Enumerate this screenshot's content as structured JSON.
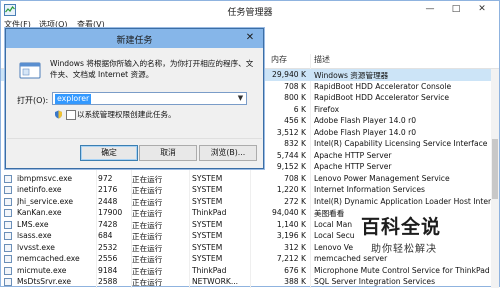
{
  "window": {
    "title": "任务管理器",
    "controls": [
      "—",
      "□",
      "✕"
    ]
  },
  "menubar": [
    {
      "label": "文件(F)"
    },
    {
      "label": "选项(O)"
    },
    {
      "label": "查看(V)"
    }
  ],
  "columns": {
    "name": "",
    "pid": "",
    "status": "",
    "user": "",
    "memory": "内存",
    "description": "描述"
  },
  "rows": [
    {
      "name": "",
      "pid": "",
      "status": "",
      "user": "",
      "memory": "29,940 K",
      "description": "Windows 资源管理器"
    },
    {
      "name": "",
      "pid": "",
      "status": "",
      "user": "",
      "memory": "708 K",
      "description": "RapidBoot HDD Accelerator Console"
    },
    {
      "name": "",
      "pid": "",
      "status": "",
      "user": "",
      "memory": "800 K",
      "description": "RapidBoot HDD Accelerator Service"
    },
    {
      "name": "",
      "pid": "",
      "status": "",
      "user": "",
      "memory": "6 K",
      "description": "Firefox"
    },
    {
      "name": "",
      "pid": "",
      "status": "",
      "user": "",
      "memory": "456 K",
      "description": "Adobe Flash Player 14.0 r0"
    },
    {
      "name": "",
      "pid": "",
      "status": "",
      "user": "",
      "memory": "3,512 K",
      "description": "Adobe Flash Player 14.0 r0"
    },
    {
      "name": "",
      "pid": "",
      "status": "",
      "user": "",
      "memory": "832 K",
      "description": "Intel(R) Capability Licensing Service Interface"
    },
    {
      "name": "",
      "pid": "",
      "status": "",
      "user": "",
      "memory": "5,744 K",
      "description": "Apache HTTP Server"
    },
    {
      "name": "",
      "pid": "",
      "status": "",
      "user": "",
      "memory": "9,152 K",
      "description": "Apache HTTP Server"
    },
    {
      "name": "ibmpmsvc.exe",
      "pid": "972",
      "status": "正在运行",
      "user": "SYSTEM",
      "memory": "708 K",
      "description": "Lenovo Power Management Service"
    },
    {
      "name": "inetinfo.exe",
      "pid": "2176",
      "status": "正在运行",
      "user": "SYSTEM",
      "memory": "1,220 K",
      "description": "Internet Information Services"
    },
    {
      "name": "Jhi_service.exe",
      "pid": "2448",
      "status": "正在运行",
      "user": "SYSTEM",
      "memory": "272 K",
      "description": "Intel(R) Dynamic Application Loader Host Interface"
    },
    {
      "name": "KanKan.exe",
      "pid": "17900",
      "status": "正在运行",
      "user": "ThinkPad",
      "memory": "94,040 K",
      "description": "美图看看"
    },
    {
      "name": "LMS.exe",
      "pid": "7428",
      "status": "正在运行",
      "user": "SYSTEM",
      "memory": "1,140 K",
      "description": "Local Man"
    },
    {
      "name": "lsass.exe",
      "pid": "684",
      "status": "正在运行",
      "user": "SYSTEM",
      "memory": "3,196 K",
      "description": "Local Secu"
    },
    {
      "name": "lvvsst.exe",
      "pid": "2532",
      "status": "正在运行",
      "user": "SYSTEM",
      "memory": "312 K",
      "description": "Lenovo Ve"
    },
    {
      "name": "memcached.exe",
      "pid": "2556",
      "status": "正在运行",
      "user": "SYSTEM",
      "memory": "7,212 K",
      "description": "memcached server"
    },
    {
      "name": "micmute.exe",
      "pid": "9184",
      "status": "正在运行",
      "user": "ThinkPad",
      "memory": "676 K",
      "description": "Microphone Mute Control Service for ThinkPad"
    },
    {
      "name": "MsDtsSrvr.exe",
      "pid": "2588",
      "status": "正在运行",
      "user": "NETWORK...",
      "memory": "388 K",
      "description": "SQL Server Integration Services"
    }
  ],
  "dialog": {
    "title": "新建任务",
    "close": "✕",
    "description": "Windows 将根据你所输入的名称，为你打开相应的程序、文件夹、文档或 Internet 资源。",
    "open_label": "打开(O):",
    "input_value": "explorer",
    "checkbox_label": "以系统管理权限创建此任务。",
    "buttons": {
      "ok": "确定",
      "cancel": "取消",
      "browse": "浏览(B)..."
    }
  },
  "watermark": {
    "logo": "百科全说",
    "sub": "助你轻松解决"
  }
}
